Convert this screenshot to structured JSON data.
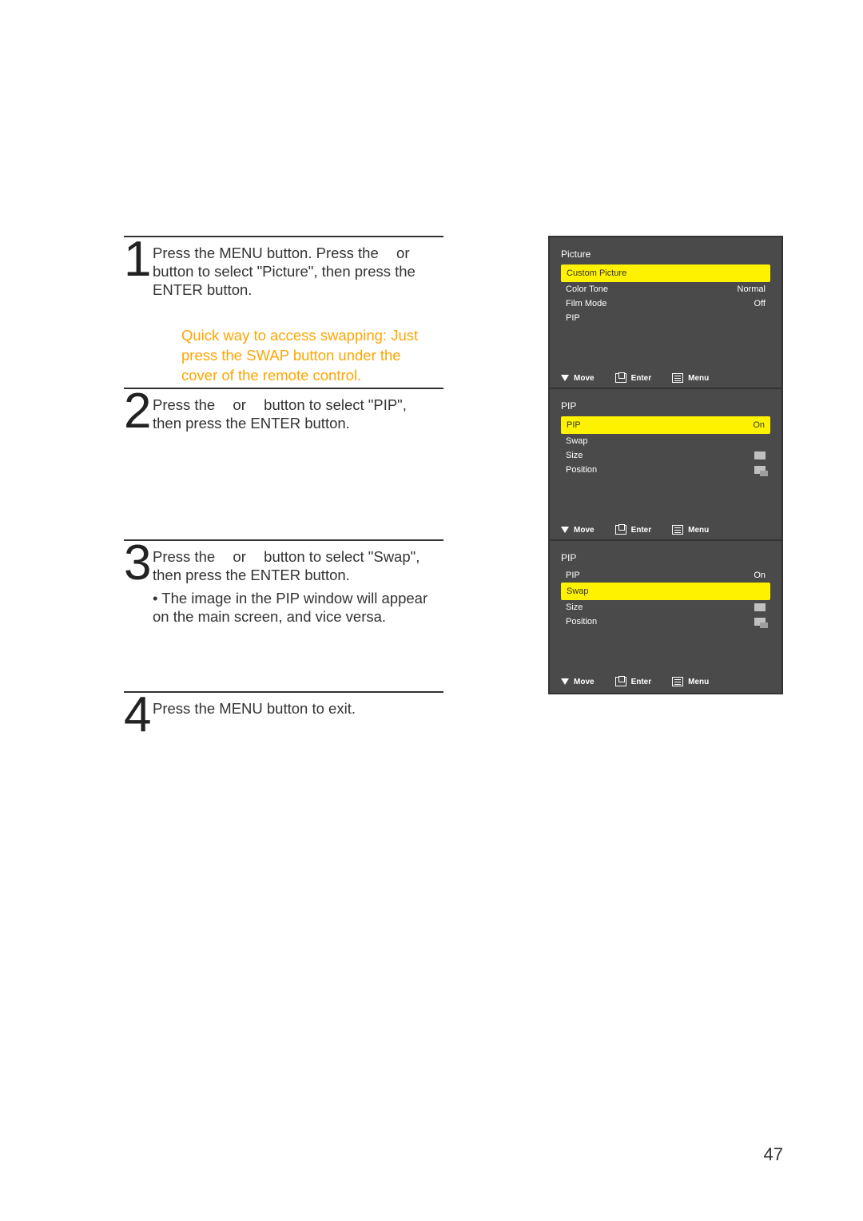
{
  "page_number": "47",
  "steps": {
    "1": {
      "num": "1",
      "text_a": "Press the MENU button. Press the ",
      "or": " or ",
      "text_b": " button to select \"Picture\", then press the ENTER button.",
      "tip": "Quick way to access swapping: Just press the SWAP button under the cover of the remote control."
    },
    "2": {
      "num": "2",
      "text_a": "Press the ",
      "or": " or ",
      "text_b": " button to select \"PIP\", then press the ENTER button."
    },
    "3": {
      "num": "3",
      "text_a": "Press the ",
      "or": " or ",
      "text_b": " button to select \"Swap\", then press the ENTER button.",
      "bullet": "• The image in the PIP window will appear on the main screen, and vice versa."
    },
    "4": {
      "num": "4",
      "text": "Press the MENU button to exit."
    }
  },
  "osd": {
    "common": {
      "footer_move": "Move",
      "footer_enter": "Enter",
      "footer_menu": "Menu"
    },
    "1": {
      "title": "Picture",
      "hl_label": "Custom Picture",
      "rows": [
        {
          "l": "Color Tone",
          "v": "Normal"
        },
        {
          "l": "Film Mode",
          "v": "Off"
        },
        {
          "l": "PIP",
          "v": ""
        }
      ]
    },
    "2": {
      "title": "PIP",
      "hl_label": "PIP",
      "hl_val": "On",
      "rows": [
        {
          "l": "Swap",
          "v": ""
        },
        {
          "l": "Size",
          "v": "mini"
        },
        {
          "l": "Position",
          "v": "mini-stack"
        }
      ]
    },
    "3": {
      "title": "PIP",
      "rows_top": [
        {
          "l": "PIP",
          "v": "On"
        }
      ],
      "hl_label": "Swap",
      "rows": [
        {
          "l": "Size",
          "v": "mini"
        },
        {
          "l": "Position",
          "v": "mini-stack"
        }
      ]
    }
  }
}
